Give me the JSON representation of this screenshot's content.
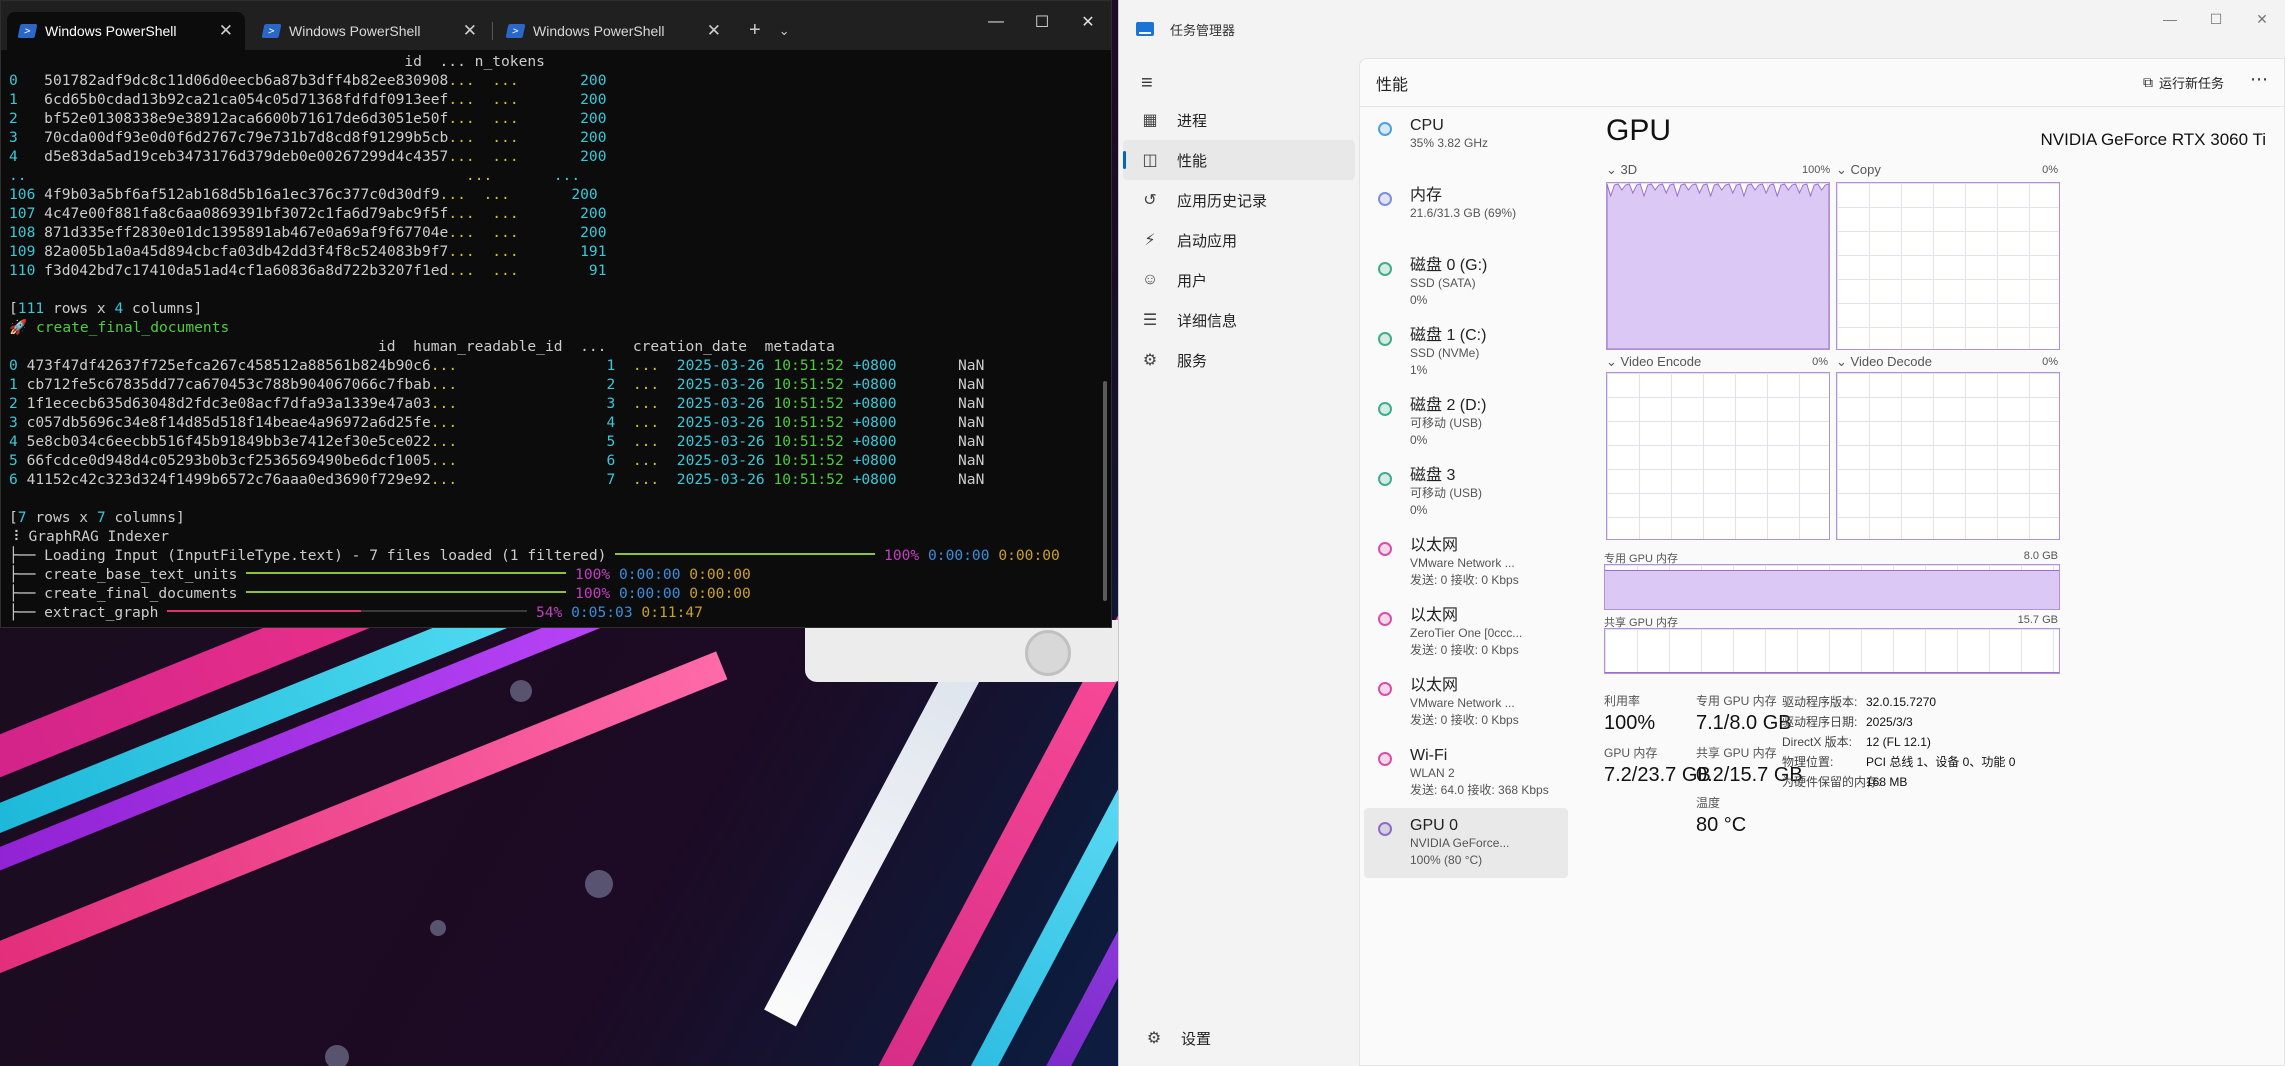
{
  "terminal": {
    "tabs": [
      "Windows PowerShell",
      "Windows PowerShell",
      "Windows PowerShell"
    ],
    "table1_header": "id  ... n_tokens",
    "table1_rows": [
      {
        "i": "0",
        "id": "501782adf9dc8c11d06d0eecb6a87b3dff4b82ee830908",
        "n": "200"
      },
      {
        "i": "1",
        "id": "6cd65b0cdad13b92ca21ca054c05d71368fdfdf0913eef",
        "n": "200"
      },
      {
        "i": "2",
        "id": "bf52e01308338e9e38912aca6600b71617de6d3051e50f",
        "n": "200"
      },
      {
        "i": "3",
        "id": "70cda00df93e0d0f6d2767c79e731b7d8cd8f91299b5cb",
        "n": "200"
      },
      {
        "i": "4",
        "id": "d5e83da5ad19ceb3473176d379deb0e00267299d4c4357",
        "n": "200"
      },
      {
        "i": "..",
        "id": "",
        "n": "..."
      },
      {
        "i": "106",
        "id": "4f9b03a5bf6af512ab168d5b16a1ec376c377c0d30df9",
        "n": "200"
      },
      {
        "i": "107",
        "id": "4c47e00f881fa8c6aa0869391bf3072c1fa6d79abc9f5f",
        "n": "200"
      },
      {
        "i": "108",
        "id": "871d335eff2830e01dc1395891ab467e0a69af9f67704e",
        "n": "200"
      },
      {
        "i": "109",
        "id": "82a005b1a0a45d894cbcfa03db42dd3f4f8c524083b9f7",
        "n": "191"
      },
      {
        "i": "110",
        "id": "f3d042bd7c17410da51ad4cf1a60836a8d722b3207f1ed",
        "n": "91"
      }
    ],
    "table1_summary": "[111 rows x 4 columns]",
    "step_name": "create_final_documents",
    "table2_header": "id  human_readable_id  ...   creation_date  metadata",
    "table2_rows": [
      {
        "i": "0",
        "id": "473f47df42637f725efca267c458512a88561b824b90c6",
        "hr": "1",
        "date": "2025-03-26",
        "time": "10:51:52",
        "tz": "+0800",
        "meta": "NaN"
      },
      {
        "i": "1",
        "id": "cb712fe5c67835dd77ca670453c788b904067066c7fbab",
        "hr": "2",
        "date": "2025-03-26",
        "time": "10:51:52",
        "tz": "+0800",
        "meta": "NaN"
      },
      {
        "i": "2",
        "id": "1f1ececb635d63048d2fdc3e08acf7dfa93a1339e47a03",
        "hr": "3",
        "date": "2025-03-26",
        "time": "10:51:52",
        "tz": "+0800",
        "meta": "NaN"
      },
      {
        "i": "3",
        "id": "c057db5696c34e8f14d85d518f14beae4a96972a6d25fe",
        "hr": "4",
        "date": "2025-03-26",
        "time": "10:51:52",
        "tz": "+0800",
        "meta": "NaN"
      },
      {
        "i": "4",
        "id": "5e8cb034c6eecbb516f45b91849bb3e7412ef30e5ce022",
        "hr": "5",
        "date": "2025-03-26",
        "time": "10:51:52",
        "tz": "+0800",
        "meta": "NaN"
      },
      {
        "i": "5",
        "id": "66fcdce0d948d4c05293b0b3cf2536569490be6dcf1005",
        "hr": "6",
        "date": "2025-03-26",
        "time": "10:51:52",
        "tz": "+0800",
        "meta": "NaN"
      },
      {
        "i": "6",
        "id": "41152c42c323d324f1499b6572c76aaa0ed3690f729e92",
        "hr": "7",
        "date": "2025-03-26",
        "time": "10:51:52",
        "tz": "+0800",
        "meta": "NaN"
      }
    ],
    "table2_summary": "[7 rows x 7 columns]",
    "indexer_title": "GraphRAG Indexer",
    "progress": [
      {
        "label": "Loading Input (InputFileType.text) - 7 files loaded (1 filtered)",
        "pct": "100%",
        "elapsed": "0:00:00",
        "remain": "0:00:00",
        "fraction": 1.0
      },
      {
        "label": "create_base_text_units",
        "pct": "100%",
        "elapsed": "0:00:00",
        "remain": "0:00:00",
        "fraction": 1.0
      },
      {
        "label": "create_final_documents",
        "pct": "100%",
        "elapsed": "0:00:00",
        "remain": "0:00:00",
        "fraction": 1.0
      },
      {
        "label": "extract_graph",
        "pct": "54%",
        "elapsed": "0:05:03",
        "remain": "0:11:47",
        "fraction": 0.54
      }
    ]
  },
  "taskmgr": {
    "title": "任务管理器",
    "nav": [
      {
        "label": "进程",
        "icon": "processes-icon"
      },
      {
        "label": "性能",
        "icon": "performance-icon"
      },
      {
        "label": "应用历史记录",
        "icon": "history-icon"
      },
      {
        "label": "启动应用",
        "icon": "startup-icon"
      },
      {
        "label": "用户",
        "icon": "users-icon"
      },
      {
        "label": "详细信息",
        "icon": "details-icon"
      },
      {
        "label": "服务",
        "icon": "services-icon"
      }
    ],
    "settings_label": "设置",
    "header": "性能",
    "run_new_task": "运行新任务",
    "devices": [
      {
        "name": "CPU",
        "s1": "35% 3.82 GHz",
        "s2": "",
        "color": "#4aa3df"
      },
      {
        "name": "内存",
        "s1": "21.6/31.3 GB (69%)",
        "s2": "",
        "color": "#7b8ee0"
      },
      {
        "name": "磁盘 0 (G:)",
        "s1": "SSD (SATA)",
        "s2": "0%",
        "color": "#3fae8a"
      },
      {
        "name": "磁盘 1 (C:)",
        "s1": "SSD (NVMe)",
        "s2": "1%",
        "color": "#3fae8a"
      },
      {
        "name": "磁盘 2 (D:)",
        "s1": "可移动 (USB)",
        "s2": "0%",
        "color": "#3fae8a"
      },
      {
        "name": "磁盘 3",
        "s1": "可移动 (USB)",
        "s2": "0%",
        "color": "#3fae8a"
      },
      {
        "name": "以太网",
        "s1": "VMware Network ...",
        "s2": "发送: 0 接收: 0 Kbps",
        "color": "#d84fa8"
      },
      {
        "name": "以太网",
        "s1": "ZeroTier One [0ccc...",
        "s2": "发送: 0 接收: 0 Kbps",
        "color": "#d84fa8"
      },
      {
        "name": "以太网",
        "s1": "VMware Network ...",
        "s2": "发送: 0 接收: 0 Kbps",
        "color": "#d84fa8"
      },
      {
        "name": "Wi-Fi",
        "s1": "WLAN 2",
        "s2": "发送: 64.0 接收: 368 Kbps",
        "color": "#d84fa8"
      },
      {
        "name": "GPU 0",
        "s1": "NVIDIA GeForce...",
        "s2": "100% (80 °C)",
        "color": "#8e6cc6"
      }
    ],
    "gpu": {
      "title": "GPU",
      "model": "NVIDIA GeForce RTX 3060 Ti",
      "engines": [
        {
          "label": "3D",
          "pct": "100%"
        },
        {
          "label": "Copy",
          "pct": "0%"
        },
        {
          "label": "Video Encode",
          "pct": "0%"
        },
        {
          "label": "Video Decode",
          "pct": "0%"
        }
      ],
      "dedicated_label": "专用 GPU 内存",
      "dedicated_max": "8.0 GB",
      "dedicated_fraction": 0.89,
      "shared_label": "共享 GPU 内存",
      "shared_max": "15.7 GB",
      "shared_fraction": 0.013,
      "stats": [
        {
          "label": "利用率",
          "value": "100%"
        },
        {
          "label": "专用 GPU 内存",
          "value": "7.1/8.0 GB"
        },
        {
          "label": "GPU 内存",
          "value": "7.2/23.7 GB"
        },
        {
          "label": "共享 GPU 内存",
          "value": "0.2/15.7 GB"
        },
        {
          "label": "温度",
          "value": "80 °C"
        }
      ],
      "props": [
        {
          "k": "驱动程序版本:",
          "v": "32.0.15.7270"
        },
        {
          "k": "驱动程序日期:",
          "v": "2025/3/3"
        },
        {
          "k": "DirectX 版本:",
          "v": "12 (FL 12.1)"
        },
        {
          "k": "物理位置:",
          "v": "PCI 总线 1、设备 0、功能 0"
        },
        {
          "k": "为硬件保留的内存:",
          "v": "168 MB"
        }
      ]
    }
  }
}
